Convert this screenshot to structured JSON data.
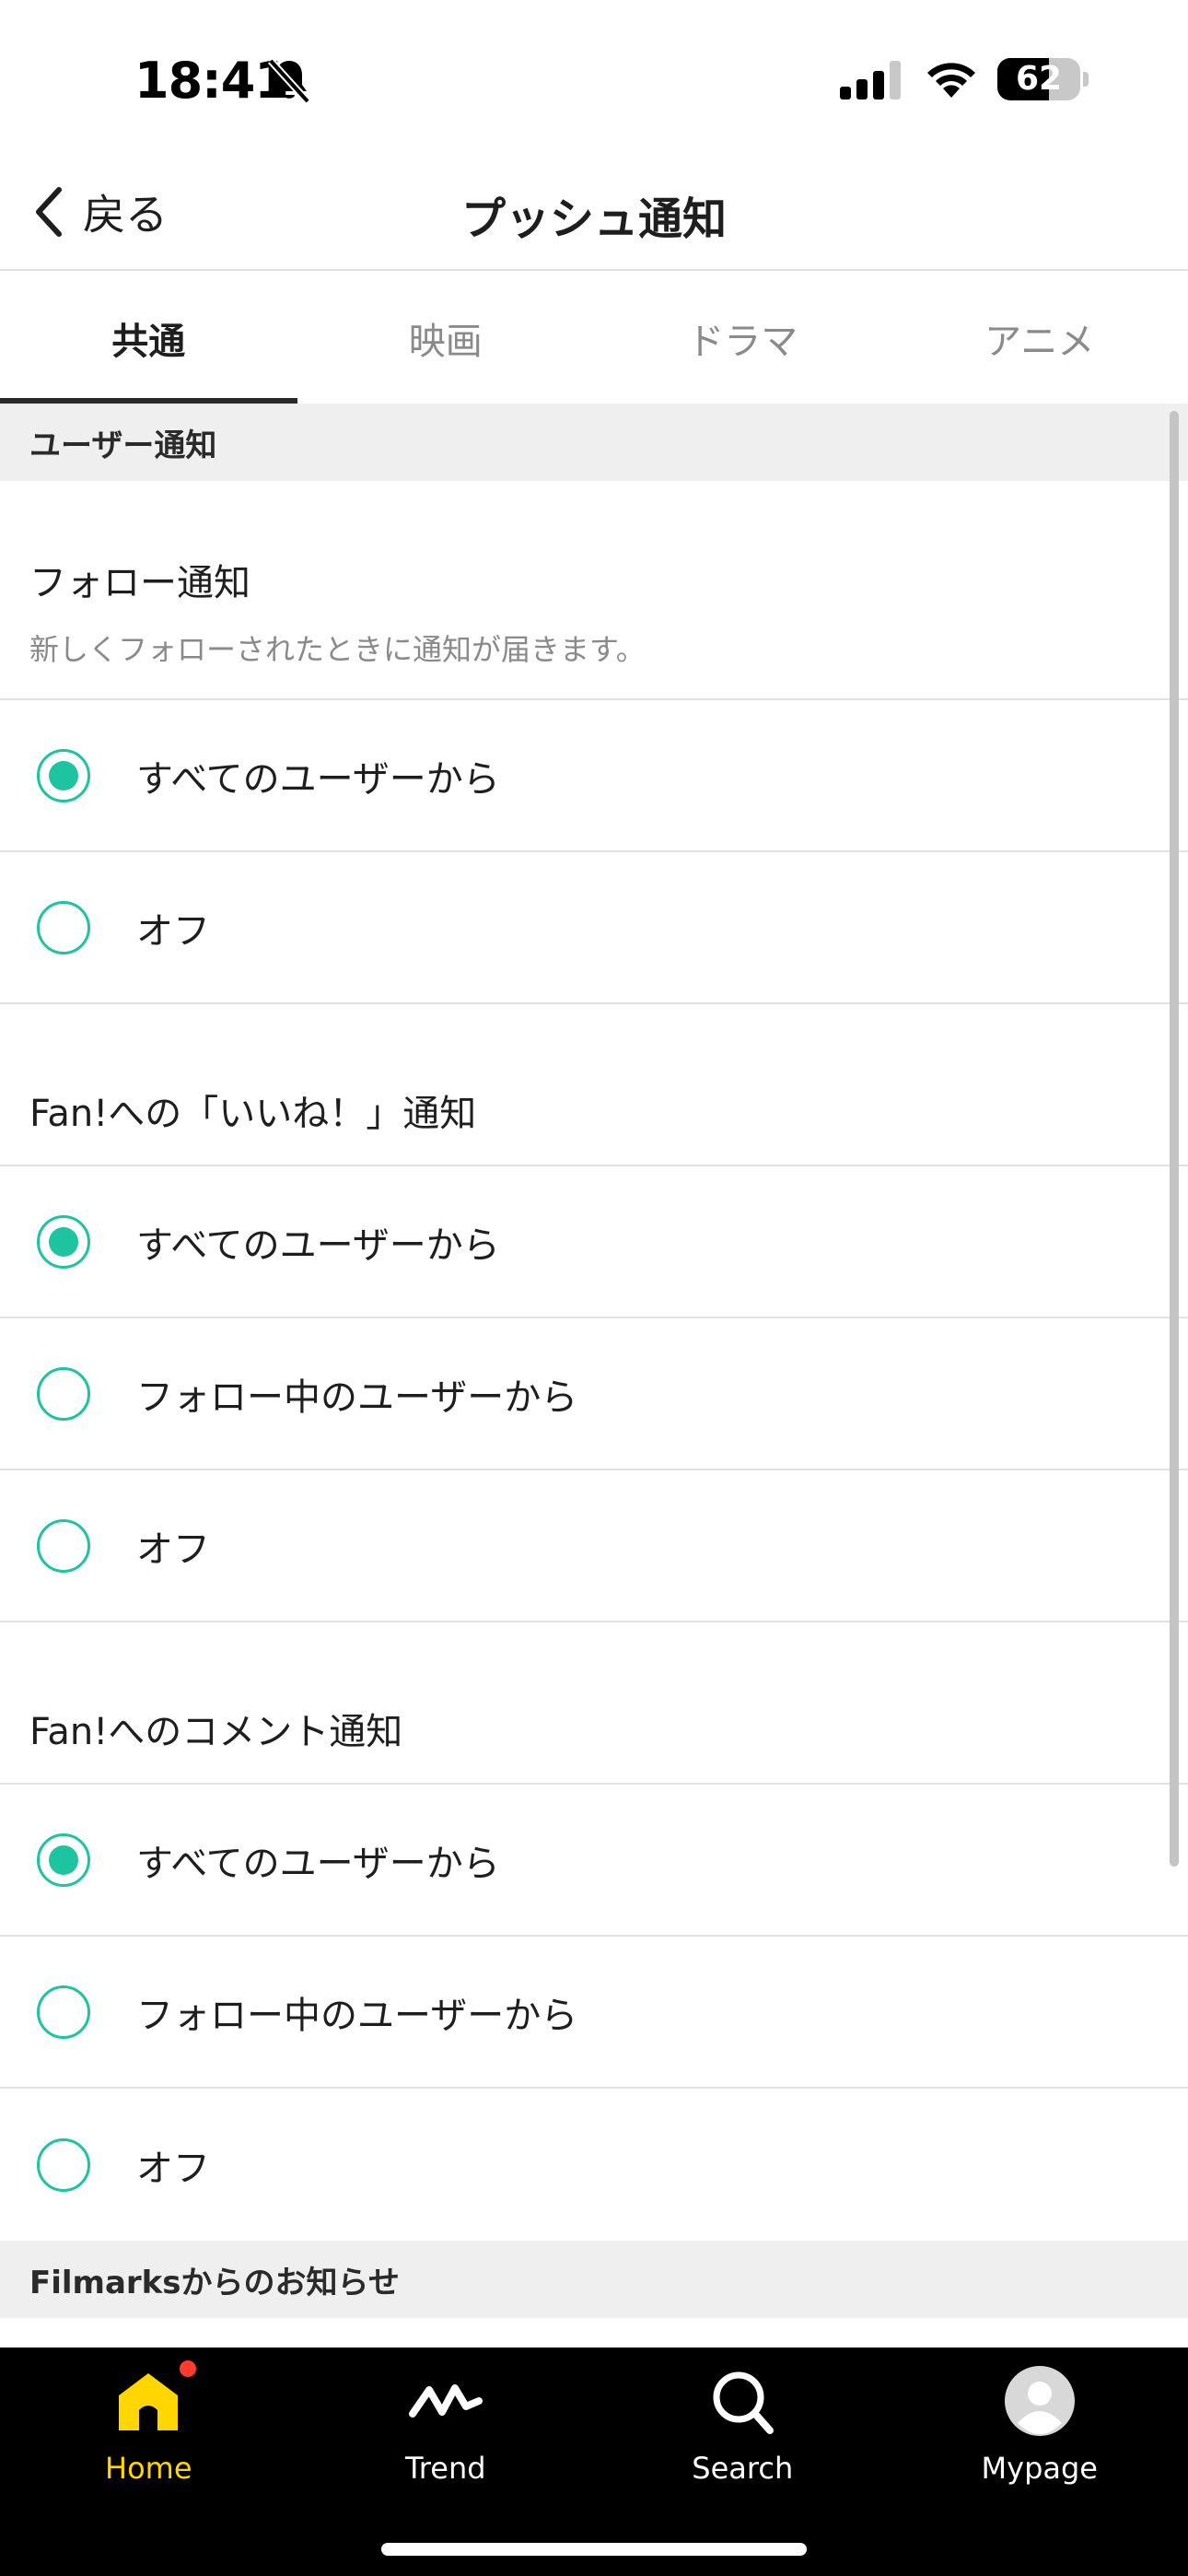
{
  "status_bar": {
    "time": "18:41",
    "battery_level": "62",
    "battery_fraction": 0.62
  },
  "nav": {
    "back_label": "戻る",
    "title": "プッシュ通知"
  },
  "tabs": [
    {
      "label": "共通",
      "active": true
    },
    {
      "label": "映画",
      "active": false
    },
    {
      "label": "ドラマ",
      "active": false
    },
    {
      "label": "アニメ",
      "active": false
    }
  ],
  "sections": {
    "user_notifications": "ユーザー通知",
    "filmarks_news": "Filmarksからのお知らせ"
  },
  "groups": {
    "follow": {
      "title": "フォロー通知",
      "description": "新しくフォローされたときに通知が届きます。",
      "options": [
        {
          "label": "すべてのユーザーから",
          "selected": true
        },
        {
          "label": "オフ",
          "selected": false
        }
      ]
    },
    "like": {
      "title": "Fan!への「いいね！」通知",
      "options": [
        {
          "label": "すべてのユーザーから",
          "selected": true
        },
        {
          "label": "フォロー中のユーザーから",
          "selected": false
        },
        {
          "label": "オフ",
          "selected": false
        }
      ]
    },
    "comment": {
      "title": "Fan!へのコメント通知",
      "options": [
        {
          "label": "すべてのユーザーから",
          "selected": true
        },
        {
          "label": "フォロー中のユーザーから",
          "selected": false
        },
        {
          "label": "オフ",
          "selected": false
        }
      ]
    }
  },
  "bottom_nav": [
    {
      "label": "Home",
      "icon": "home-icon",
      "active": true,
      "badge": true
    },
    {
      "label": "Trend",
      "icon": "trend-icon",
      "active": false
    },
    {
      "label": "Search",
      "icon": "search-icon",
      "active": false
    },
    {
      "label": "Mypage",
      "icon": "avatar-icon",
      "active": false
    }
  ],
  "colors": {
    "accent": "#1ec3a0",
    "active_tab_bar": "#ffd600",
    "badge": "#ff3b30"
  }
}
